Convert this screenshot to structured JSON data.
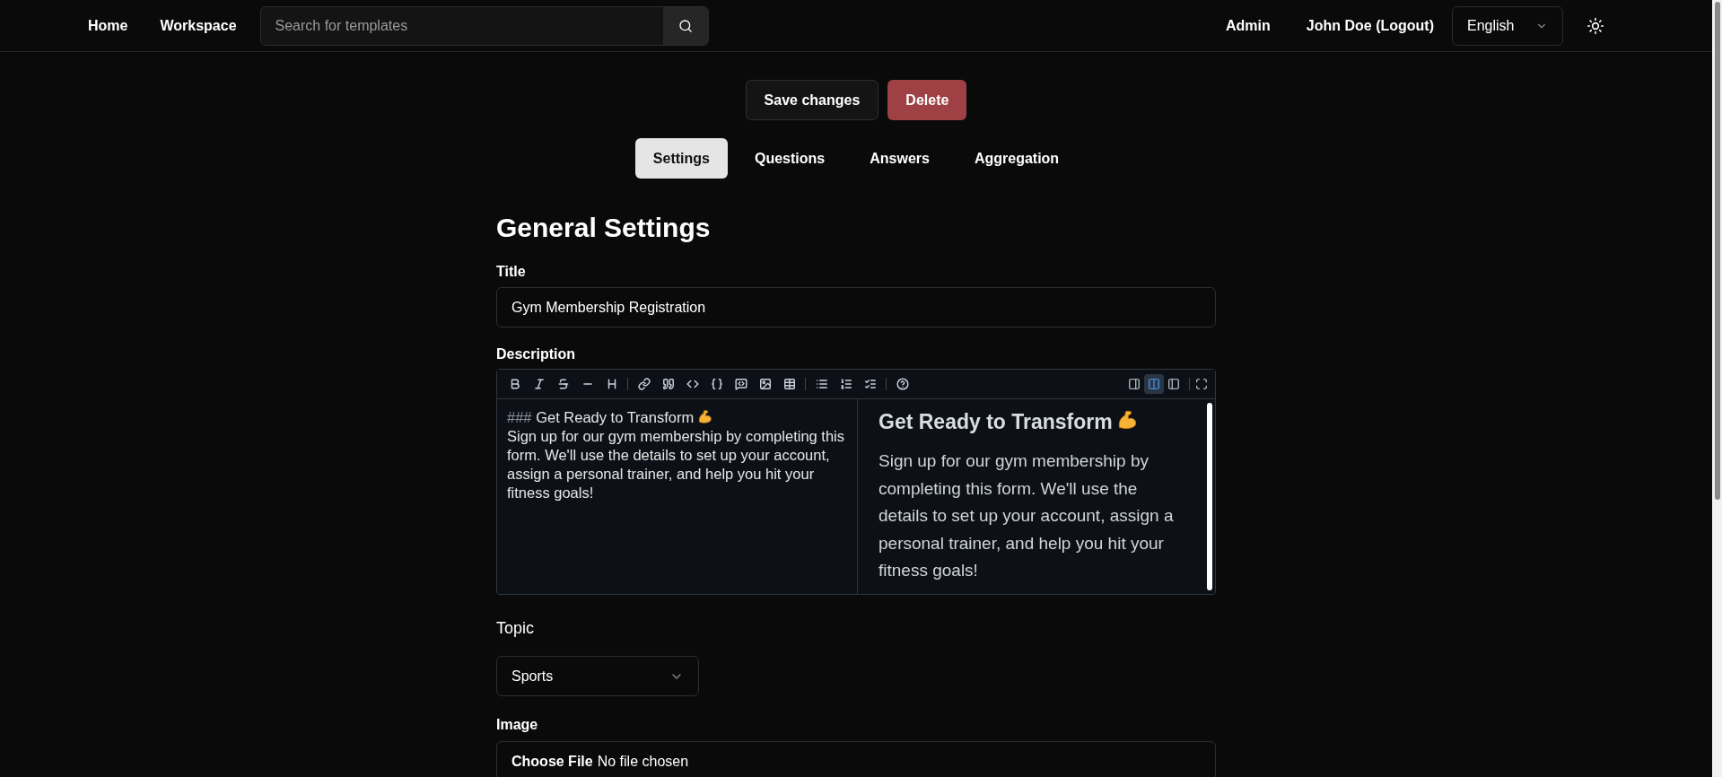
{
  "navbar": {
    "links": [
      "Home",
      "Workspace"
    ],
    "search": {
      "placeholder": "Search for templates"
    },
    "admin_link": "Admin",
    "user_link": "John Doe (Logout)",
    "language": "English"
  },
  "actions": {
    "save": "Save changes",
    "delete": "Delete"
  },
  "tabs": [
    {
      "label": "Settings",
      "selected": true
    },
    {
      "label": "Questions",
      "selected": false
    },
    {
      "label": "Answers",
      "selected": false
    },
    {
      "label": "Aggregation",
      "selected": false
    }
  ],
  "heading": "General Settings",
  "title_field": {
    "label": "Title",
    "value": "Gym Membership Registration"
  },
  "description": {
    "label": "Description",
    "view_modes": [
      {
        "kind": "edit",
        "selected": false
      },
      {
        "kind": "live",
        "selected": true
      },
      {
        "kind": "preview",
        "selected": false
      }
    ],
    "source": {
      "marker": "###",
      "heading": "Get Ready to Transform",
      "body": "Sign up for our gym membership by completing this form. We'll use the details to set up your account, assign a personal trainer, and help you hit your fitness goals!"
    },
    "preview": {
      "heading": "Get Ready to Transform",
      "body": "Sign up for our gym membership by completing this form. We'll use the details to set up your account, assign a personal trainer, and help you hit your fitness goals!"
    }
  },
  "topic": {
    "label": "Topic",
    "value": "Sports"
  },
  "image": {
    "label": "Image",
    "button": "Choose File",
    "status": "No file chosen"
  }
}
